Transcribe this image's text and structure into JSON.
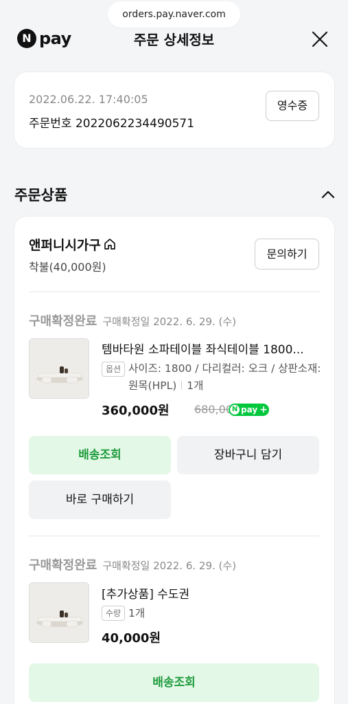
{
  "browser": {
    "url": "orders.pay.naver.com"
  },
  "header": {
    "logo_mark": "N",
    "logo_text": "pay",
    "title": "주문 상세정보"
  },
  "order": {
    "datetime": "2022.06.22. 17:40:05",
    "order_number": "주문번호 2022062234490571",
    "receipt_label": "영수증"
  },
  "section": {
    "title": "주문상품"
  },
  "seller": {
    "name": "앤퍼니시가구",
    "shipping_fee": "착불(40,000원)",
    "inquiry_label": "문의하기"
  },
  "items": [
    {
      "status": "구매확정완료",
      "confirm_date": "구매확정일 2022. 6. 29. (수)",
      "title": "템바타원 소파테이블 좌식테이블 1800...",
      "badge": "옵션",
      "option_text": "사이즈: 1800 / 다리컬러: 오크 / 상판소재: 원목(HPL)",
      "quantity": "1개",
      "price": "360,000원",
      "original_price": "680,000",
      "npay_badge": "pay",
      "buttons": {
        "track": "배송조회",
        "cart": "장바구니 담기",
        "buy_now": "바로 구매하기"
      }
    },
    {
      "status": "구매확정완료",
      "confirm_date": "구매확정일 2022. 6. 29. (수)",
      "title": "[추가상품] 수도권",
      "badge": "수량",
      "quantity": "1개",
      "price": "40,000원",
      "buttons": {
        "track": "배송조회"
      }
    }
  ],
  "colors": {
    "green": "#1d9b3c",
    "green_bg": "#e4f8e7",
    "npay_green": "#00c73c"
  },
  "icons": [
    "close-icon",
    "chevron-up-icon",
    "home-icon",
    "product-thumbnail"
  ]
}
